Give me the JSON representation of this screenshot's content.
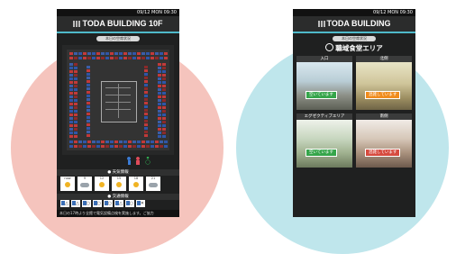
{
  "screens": [
    {
      "status_time": "09/12 MON 09:30",
      "header_title": "TODA BUILDING 10F",
      "pill": "本日の空席状況",
      "weather_label": "● 天気情報",
      "weather": [
        {
          "time": "now",
          "icon": "sun"
        },
        {
          "time": "9",
          "icon": "cloud"
        },
        {
          "time": "12",
          "icon": "sun"
        },
        {
          "time": "15",
          "icon": "sun"
        },
        {
          "time": "18",
          "icon": "sun"
        },
        {
          "time": "21",
          "icon": "cloud"
        }
      ],
      "transit_label": "● 交通情報",
      "transit": [
        "△",
        "△",
        "○",
        "○",
        "○",
        "△",
        "○",
        "✕"
      ],
      "ticker": "本日の17時より全館で電気設備点検を実施します。ご協力"
    },
    {
      "status_time": "09/12 MON 09:30",
      "header_title": "TODA BUILDING",
      "pill": "本日の空席状況",
      "area_title": "職域食堂エリア",
      "cards": [
        {
          "title": "入口",
          "badge": "空いています",
          "badge_color": "green"
        },
        {
          "title": "北側",
          "badge": "混雑しています",
          "badge_color": "orange"
        },
        {
          "title": "エグゼクティブエリア",
          "badge": "空いています",
          "badge_color": "green"
        },
        {
          "title": "南側",
          "badge": "混雑しています",
          "badge_color": "red"
        }
      ]
    }
  ],
  "colors": {
    "accent": "#4fb9c9",
    "left_circle": "#f5c4bd",
    "right_circle": "#bfe6ec"
  }
}
